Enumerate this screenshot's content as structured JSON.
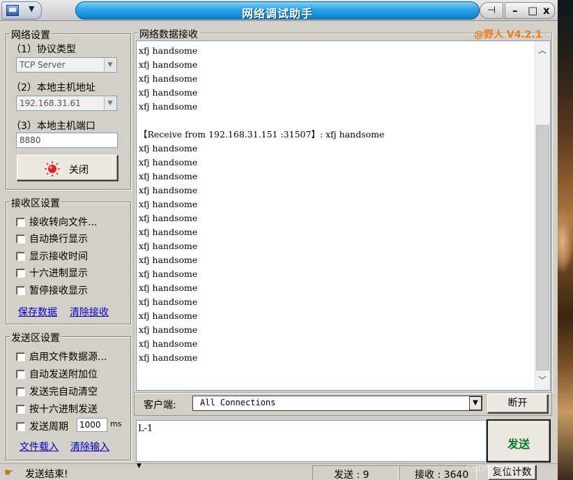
{
  "window": {
    "title": "网络调试助手",
    "pin_icon": "pin-icon",
    "minimize_label": "–",
    "maximize_label": "□",
    "close_label": "x",
    "version": "@野人 V4.2.1"
  },
  "network_settings": {
    "title": "网络设置",
    "protocol_label": "（1）协议类型",
    "protocol_value": "TCP Server",
    "host_label": "（2）本地主机地址",
    "host_value": "192.168.31.61",
    "port_label": "（3）本地主机端口",
    "port_value": "8880",
    "toggle_button": "关闭"
  },
  "receive_settings": {
    "title": "接收区设置",
    "options": [
      "接收转向文件...",
      "自动换行显示",
      "显示接收时间",
      "十六进制显示",
      "暂停接收显示"
    ],
    "save_link": "保存数据",
    "clear_link": "清除接收"
  },
  "send_settings": {
    "title": "发送区设置",
    "options": [
      "启用文件数据源...",
      "自动发送附加位",
      "发送完自动清空",
      "按十六进制发送"
    ],
    "period_label": "发送周期",
    "period_value": "1000",
    "period_unit": "ms",
    "load_link": "文件载入",
    "clear_link": "清除输入"
  },
  "receive_area": {
    "title": "网络数据接收",
    "lines_before": [
      "xfj handsome",
      "xfj handsome",
      "xfj handsome",
      "xfj handsome",
      "xfj handsome"
    ],
    "receive_header": "【Receive from 192.168.31.151 :31507】: xfj handsome",
    "lines_after": [
      "xfj handsome",
      "xfj handsome",
      "xfj handsome",
      "xfj handsome",
      "xfj handsome",
      "xfj handsome",
      "xfj handsome",
      "xfj handsome",
      "xfj handsome",
      "xfj handsome",
      "xfj handsome",
      "xfj handsome",
      "xfj handsome",
      "xfj handsome",
      "xfj handsome",
      "xfj handsome"
    ]
  },
  "client_bar": {
    "label": "客户端:",
    "selected": "All Connections",
    "disconnect_button": "断开"
  },
  "send_area": {
    "input_value": "L-1",
    "send_button": "发送"
  },
  "statusbar": {
    "status_text": "发送结束!",
    "sent_label": "发送 : 9",
    "received_label": "接收 : 3640",
    "reset_button": "复位计数",
    "watermark": "CSDN @野"
  }
}
